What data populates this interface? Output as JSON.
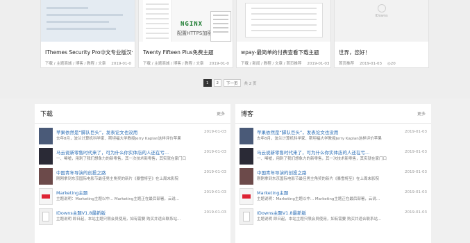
{
  "cards": [
    {
      "title": "IThemes Security Pro中文专业版汉化",
      "meta": "下载 / 主题商城 / 博客 / 教程 / 文章",
      "date": "2019-01-0"
    },
    {
      "title": "Twenty Fifteen Plus免费主题",
      "meta": "下载 / 主题商城 / 博客 / 教程 / 文章",
      "date": "2019-01-0",
      "logo": "NGINX",
      "image_text": "配置HTTPS加密"
    },
    {
      "title": "wpay-最简单的付费查看下载主题",
      "meta": "下载 / 新闻 / 教程 / 文章 / 首页推荐",
      "date": "2019-01-03"
    },
    {
      "title": "世界，您好！",
      "meta": "首页推荐",
      "date": "2019-01-03",
      "extra": "◎20",
      "logo_text": "IDowns"
    }
  ],
  "pagination": {
    "pages": [
      "1",
      "2"
    ],
    "next": "下一页",
    "info": "共 2 页"
  },
  "panels": [
    {
      "title": "下载",
      "more": "更多",
      "items": [
        {
          "title": "苹果依然是“脚队巨头”，发表论文也没用",
          "date": "2019-01-03",
          "excerpt": "去年8月，波兰计算机科学家、斯坦福大学教授Jerry Kaplan这样评价苹果"
        },
        {
          "title": "马云说新零售时代来了，可为什么你实体店的人还在亏...",
          "date": "2019-01-03",
          "excerpt": "一、唏嘘，用刺了我们想象力的新零售，其一次技术新零售，其实就在家门口"
        },
        {
          "title": "中国青年导演的创投之路",
          "date": "2019-01-03",
          "excerpt": "刚刚拿到东京国际电影节最佳男主角奖的新片《暴雪将至》在上周末影院"
        },
        {
          "title": "Marketing主题",
          "date": "2019-01-03",
          "excerpt": "主题说明：Marketing主题以中... Marketing主题正在最后部署，云说..."
        },
        {
          "title": "IDowns主题V1.8最新版",
          "date": "2019-01-03",
          "excerpt": "主题说明 即日起，本站主题只限会员使用，如有需要 购买并适合联系站..."
        }
      ]
    },
    {
      "title": "博客",
      "more": "更多",
      "items": [
        {
          "title": "苹果依然是“脚队巨头”，发表论文也没用",
          "date": "2019-01-03",
          "excerpt": "去年8月，波兰计算机科学家、斯坦福大学教授Jerry Kaplan这样评价苹果"
        },
        {
          "title": "马云说新零售时代来了，可为什么你实体店的人还在亏...",
          "date": "2019-01-03",
          "excerpt": "一、唏嘘，用刺了我们想象力的新零售，其一次技术新零售，其实就在家门口"
        },
        {
          "title": "中国青年导演的创投之路",
          "date": "2019-01-03",
          "excerpt": "刚刚拿到东京国际电影节最佳男主角奖的新片《暴雪将至》在上周末影院"
        },
        {
          "title": "Marketing主题",
          "date": "2019-01-03",
          "excerpt": "主题说明：Marketing主题以中... Marketing主题正在最后部署，云说..."
        },
        {
          "title": "IDowns主题V1.8最新版",
          "date": "2019-01-03",
          "excerpt": "主题说明 即日起，本站主题只限会员使用，如有需要 购买并适合联系站..."
        }
      ]
    }
  ]
}
